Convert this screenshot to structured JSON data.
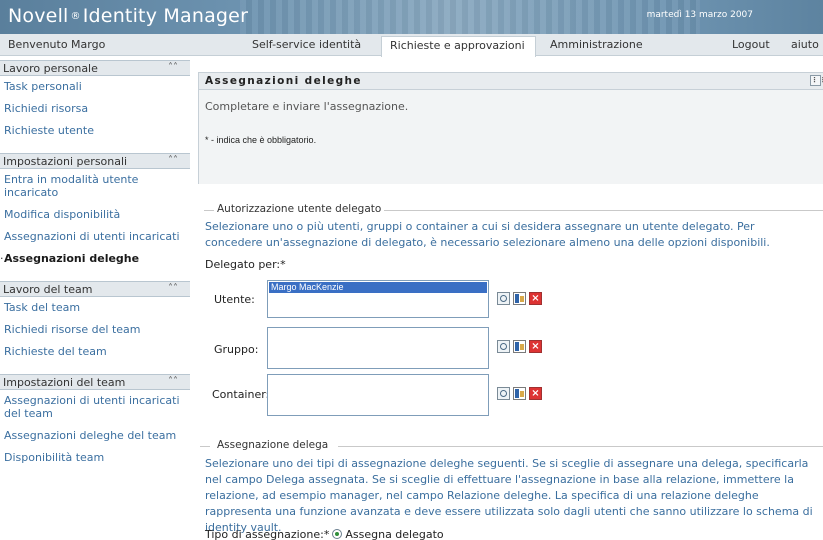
{
  "header": {
    "brand": "Novell",
    "brand_reg": "®",
    "brand_rest": "Identity Manager",
    "date": "martedì 13 marzo 2007"
  },
  "topbar": {
    "welcome": "Benvenuto Margo",
    "tabs": [
      {
        "label": "Self-service identità",
        "active": false
      },
      {
        "label": "Richieste e approvazioni",
        "active": true
      },
      {
        "label": "Amministrazione",
        "active": false
      }
    ],
    "logout": "Logout",
    "help": "aiuto"
  },
  "sidebar": {
    "sections": [
      {
        "title": "Lavoro personale",
        "items": [
          "Task personali",
          "Richiedi risorsa",
          "Richieste utente"
        ]
      },
      {
        "title": "Impostazioni personali",
        "items": [
          "Entra in modalità utente incaricato",
          "Modifica disponibilità",
          "Assegnazioni di utenti incaricati",
          "Assegnazioni deleghe"
        ]
      },
      {
        "title": "Lavoro del team",
        "items": [
          "Task del team",
          "Richiedi risorse del team",
          "Richieste del team"
        ]
      },
      {
        "title": "Impostazioni del team",
        "items": [
          "Assegnazioni di utenti incaricati del team",
          "Assegnazioni deleghe del team",
          "Disponibilità team"
        ]
      }
    ],
    "current_item": "Assegnazioni deleghe",
    "collapse_icon": "double-chevron-up-icon"
  },
  "main": {
    "title": "Assegnazioni deleghe",
    "instruction": "Completare e inviare l'assegnazione.",
    "required_note": "* - indica che è obbligatorio.",
    "delegate_section": {
      "legend": "Autorizzazione utente delegato",
      "description": "Selezionare uno o più utenti, gruppi o container a cui si desidera assegnare un utente delegato. Per concedere un'assegnazione di delegato, è necessario selezionare almeno una delle opzioni disponibili.",
      "delegate_for_label": "Delegato per:*",
      "fields": [
        {
          "label": "Utente:",
          "values": [
            "Margo MacKenzie"
          ]
        },
        {
          "label": "Gruppo:",
          "values": []
        },
        {
          "label": "Container:",
          "values": []
        }
      ]
    },
    "assignment_section": {
      "legend": "Assegnazione delega",
      "description": "Selezionare uno dei tipi di assegnazione deleghe seguenti. Se si sceglie di assegnare una delega, specificarla nel campo Delega assegnata. Se si sceglie di effettuare l'assegnazione in base alla relazione, immettere la relazione, ad esempio manager, nel campo Relazione deleghe. La specifica di una relazione deleghe rappresenta una funzione avanzata e deve essere utilizzata solo dagli utenti che sanno utilizzare lo schema di identity vault.",
      "type_label": "Tipo di assegnazione:*",
      "selected_option": "Assegna delegato"
    }
  }
}
